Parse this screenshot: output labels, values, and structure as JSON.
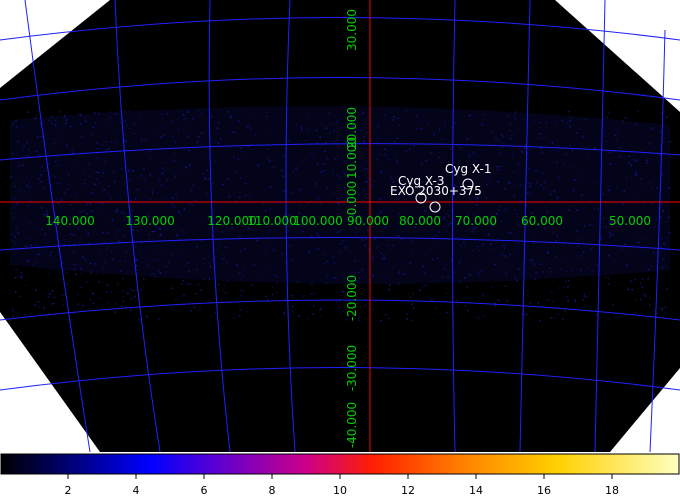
{
  "image": {
    "background_color": "#000000",
    "outside_color": "#ffffff",
    "grid_color": "#2020ff",
    "axis_color": "#ff0000",
    "label_color": "#00d200",
    "source_marker_color": "#ffffff"
  },
  "longitude_labels": [
    "140.000",
    "130.000",
    "120.000",
    "110.000",
    "100.000",
    "90.000",
    "80.000",
    "70.000",
    "60.000",
    "50.000"
  ],
  "latitude_labels": [
    "30.000",
    "20.000",
    "10.000",
    "0.000",
    "-20.000",
    "-30.000",
    "-40.000"
  ],
  "sources": [
    {
      "name": "Cyg X-1"
    },
    {
      "name": "Cyg X-3"
    },
    {
      "name": "EXO 2030+375"
    }
  ],
  "colorbar": {
    "colormap": "heat",
    "ticks": [
      "2",
      "4",
      "6",
      "8",
      "10",
      "12",
      "14",
      "16",
      "18"
    ]
  }
}
